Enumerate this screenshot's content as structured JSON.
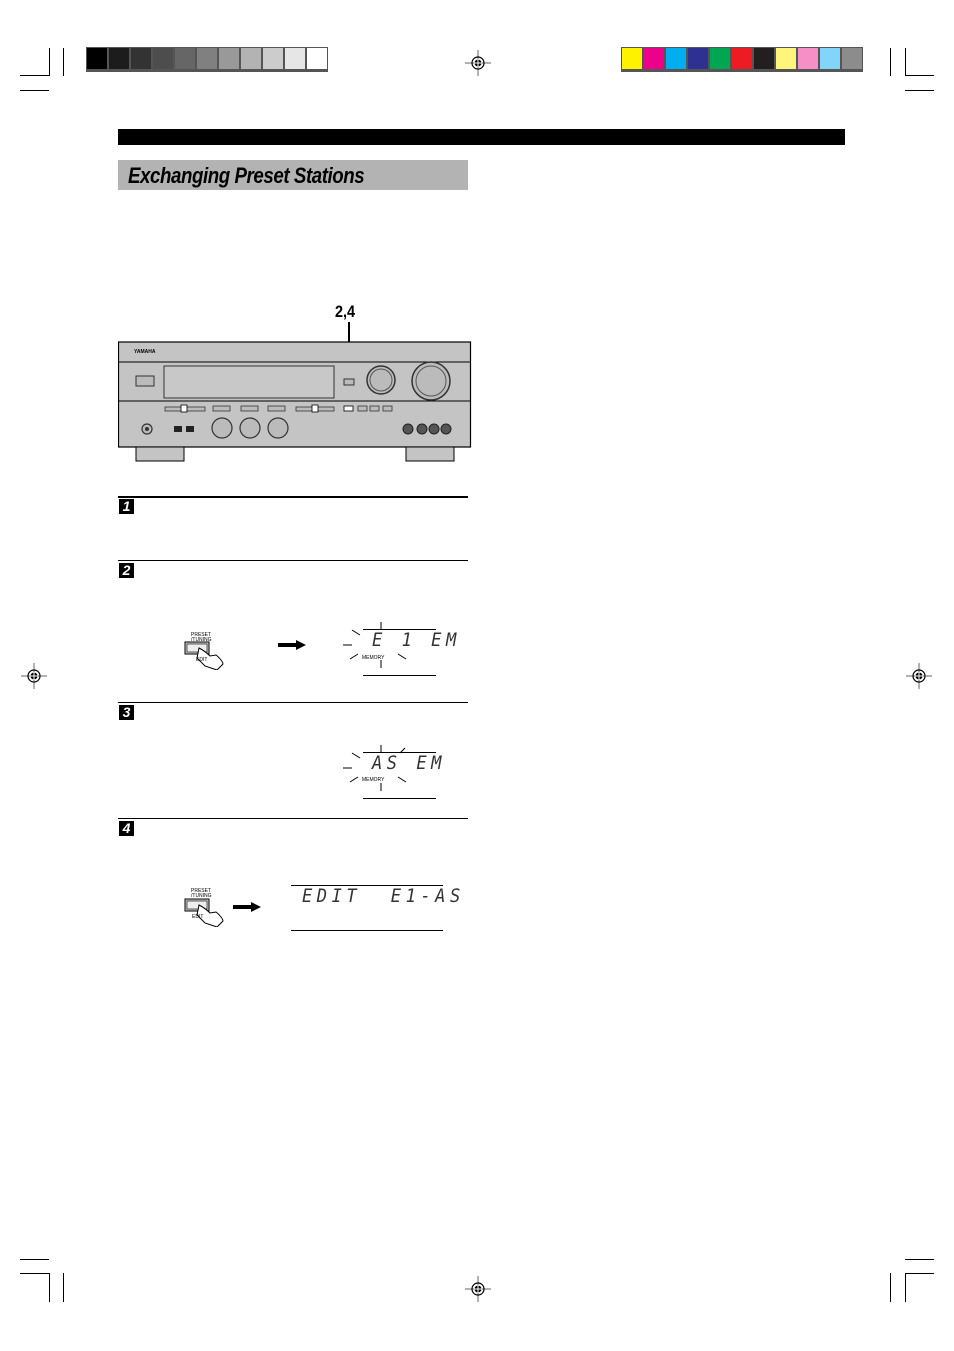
{
  "print_marks": {
    "grayscale_swatches": [
      "#000000",
      "#1c1c1c",
      "#333333",
      "#4d4d4d",
      "#666666",
      "#808080",
      "#999999",
      "#b3b3b3",
      "#cccccc",
      "#e6e6e6",
      "#ffffff"
    ],
    "color_swatches": [
      "#fff200",
      "#ec008c",
      "#00aeef",
      "#2e3192",
      "#00a651",
      "#ed1c24",
      "#231f20",
      "#fff57a",
      "#f68fc6",
      "#82d5f8",
      "#8c8c8c"
    ]
  },
  "section": {
    "title": "Exchanging Preset Stations",
    "callout": "2,4"
  },
  "receiver": {
    "brand": "YAMAHA"
  },
  "steps": [
    {
      "number": "1"
    },
    {
      "number": "2",
      "button_label_top": "PRESET",
      "button_label_mid": "/TUNING",
      "button_label_bottom": "EDIT",
      "display_text": "E 1 EM",
      "display_label": "MEMORY"
    },
    {
      "number": "3",
      "display_text": "AS EM",
      "display_label": "MEMORY"
    },
    {
      "number": "4",
      "button_label_top": "PRESET",
      "button_label_mid": "/TUNING",
      "button_label_bottom": "EDIT",
      "display_text": "EDIT  E1-AS"
    }
  ]
}
